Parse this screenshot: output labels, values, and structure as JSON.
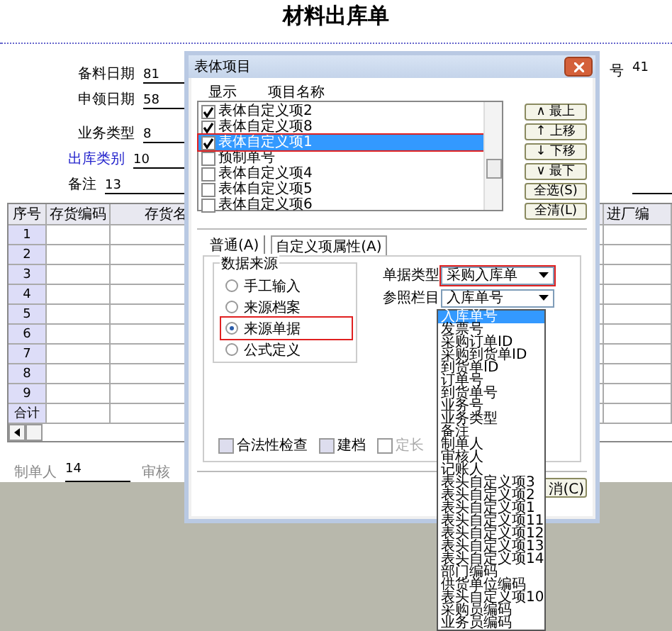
{
  "form": {
    "title": "材料出库单",
    "fields": [
      {
        "label": "备料日期",
        "value": "81",
        "kind": "plain"
      },
      {
        "label": "申领日期",
        "value": "58",
        "kind": "plain"
      },
      {
        "label": "业务类型",
        "value": "8",
        "kind": "plain"
      },
      {
        "label": "出库类别",
        "value": "10",
        "kind": "link"
      },
      {
        "label": "备注",
        "value": "13",
        "kind": "plain"
      }
    ],
    "right_field": {
      "label": "号",
      "value": "41"
    },
    "table": {
      "columns": [
        "序号",
        "存货编码",
        "存货名",
        "进厂编"
      ],
      "rows": [
        "1",
        "2",
        "3",
        "4",
        "5",
        "6",
        "7",
        "8",
        "9"
      ],
      "total_label": "合计"
    },
    "footer": [
      {
        "label": "制单人",
        "value": "14"
      },
      {
        "label": "审核"
      }
    ]
  },
  "dialog": {
    "title": "表体项目",
    "list_header": [
      "显示",
      "项目名称"
    ],
    "items": [
      {
        "label": "表体自定义项2",
        "checked": true,
        "selected": false,
        "highlighted": false
      },
      {
        "label": "表体自定义项8",
        "checked": true,
        "selected": false,
        "highlighted": false
      },
      {
        "label": "表体自定义项1",
        "checked": true,
        "selected": true,
        "highlighted": true
      },
      {
        "label": "预制单号",
        "checked": false,
        "selected": false,
        "highlighted": false
      },
      {
        "label": "表体自定义项4",
        "checked": false,
        "selected": false,
        "highlighted": false
      },
      {
        "label": "表体自定义项5",
        "checked": false,
        "selected": false,
        "highlighted": false
      },
      {
        "label": "表体自定义项6",
        "checked": false,
        "selected": false,
        "highlighted": false
      }
    ],
    "buttons": [
      {
        "icon": "∧",
        "label": "最上"
      },
      {
        "icon": "↑",
        "label": "上移"
      },
      {
        "icon": "↓",
        "label": "下移"
      },
      {
        "icon": "∨",
        "label": "最下"
      },
      {
        "label": "全选(S)"
      },
      {
        "label": "全清(L)"
      }
    ],
    "tabs": [
      {
        "label": "普通(A)",
        "selected": false
      },
      {
        "label": "自定义项属性(A)",
        "selected": true
      }
    ],
    "group_title": "数据来源",
    "radios": [
      {
        "label": "手工输入",
        "selected": false,
        "highlighted": false
      },
      {
        "label": "来源档案",
        "selected": false,
        "highlighted": false
      },
      {
        "label": "来源单据",
        "selected": true,
        "highlighted": true
      },
      {
        "label": "公式定义",
        "selected": false,
        "highlighted": false
      }
    ],
    "doc_type": {
      "label": "单据类型",
      "value": "采购入库单",
      "highlighted": true
    },
    "ref_column": {
      "label": "参照栏目",
      "value": "入库单号",
      "options": [
        {
          "label": "入库单号",
          "selected": true
        },
        {
          "label": "发票号",
          "selected": false
        },
        {
          "label": "采购订单ID",
          "selected": false
        },
        {
          "label": "采购到货单ID",
          "selected": false
        },
        {
          "label": "到货单ID",
          "selected": false
        },
        {
          "label": "订单号",
          "selected": false
        },
        {
          "label": "到货单号",
          "selected": false
        },
        {
          "label": "业务号",
          "selected": false
        },
        {
          "label": "业务类型",
          "selected": false
        },
        {
          "label": "备注",
          "selected": false
        },
        {
          "label": "制单人",
          "selected": false
        },
        {
          "label": "审核人",
          "selected": false
        },
        {
          "label": "记账人",
          "selected": false
        },
        {
          "label": "表头自定义项3",
          "selected": false
        },
        {
          "label": "表头自定义项2",
          "selected": false
        },
        {
          "label": "表头自定义项1",
          "selected": false
        },
        {
          "label": "表头自定义项11",
          "selected": false
        },
        {
          "label": "表头自定义项12",
          "selected": false
        },
        {
          "label": "表头自定义项13",
          "selected": false
        },
        {
          "label": "表头自定义项14",
          "selected": false
        },
        {
          "label": "部门编码",
          "selected": false
        },
        {
          "label": "供货单位编码",
          "selected": false
        },
        {
          "label": "表头自定义项10",
          "selected": false
        },
        {
          "label": "采购员编码",
          "selected": false
        },
        {
          "label": "业务员编码",
          "selected": false
        }
      ]
    },
    "checkboxes": [
      {
        "label": "合法性检查",
        "checked": false,
        "disabled": false
      },
      {
        "label": "建档",
        "checked": false,
        "disabled": false
      },
      {
        "label": "定长",
        "checked": false,
        "disabled": true
      }
    ],
    "cancel_button": "消(C)"
  }
}
